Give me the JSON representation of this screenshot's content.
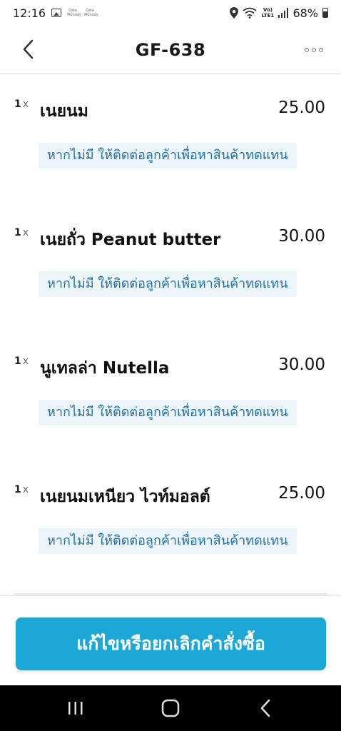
{
  "status_bar": {
    "time": "12:16",
    "mini_label_1": "Date Monday",
    "mini_label_2": "Date Monday",
    "lte_label": "Vo) LTE1",
    "battery": "68%"
  },
  "header": {
    "title": "GF-638"
  },
  "items": [
    {
      "qty": "1",
      "qty_sep": "x",
      "name": "เนยนม",
      "price": "25.00",
      "note": "หากไม่มี ให้ติดต่อลูกค้าเพื่อหาสินค้าทดแทน"
    },
    {
      "qty": "1",
      "qty_sep": "x",
      "name": "เนยถั่ว Peanut butter",
      "price": "30.00",
      "note": "หากไม่มี ให้ติดต่อลูกค้าเพื่อหาสินค้าทดแทน"
    },
    {
      "qty": "1",
      "qty_sep": "x",
      "name": "นูเทลล่า Nutella",
      "price": "30.00",
      "note": "หากไม่มี ให้ติดต่อลูกค้าเพื่อหาสินค้าทดแทน"
    },
    {
      "qty": "1",
      "qty_sep": "x",
      "name": "เนยนมเหนียว ไวท์มอลต์",
      "price": "25.00",
      "note": "หากไม่มี ให้ติดต่อลูกค้าเพื่อหาสินค้าทดแทน"
    }
  ],
  "footer": {
    "action_label": "แก้ไขหรือยกเลิกคำสั่งซื้อ"
  },
  "colors": {
    "accent": "#1ba8d6",
    "note_bg": "#edf6fb",
    "note_text": "#1f6fa8"
  },
  "icons": {
    "back": "chevron-left-icon",
    "more": "more-horizontal-icon",
    "nav_recents": "recents-icon",
    "nav_home": "home-icon",
    "nav_back": "back-icon"
  }
}
